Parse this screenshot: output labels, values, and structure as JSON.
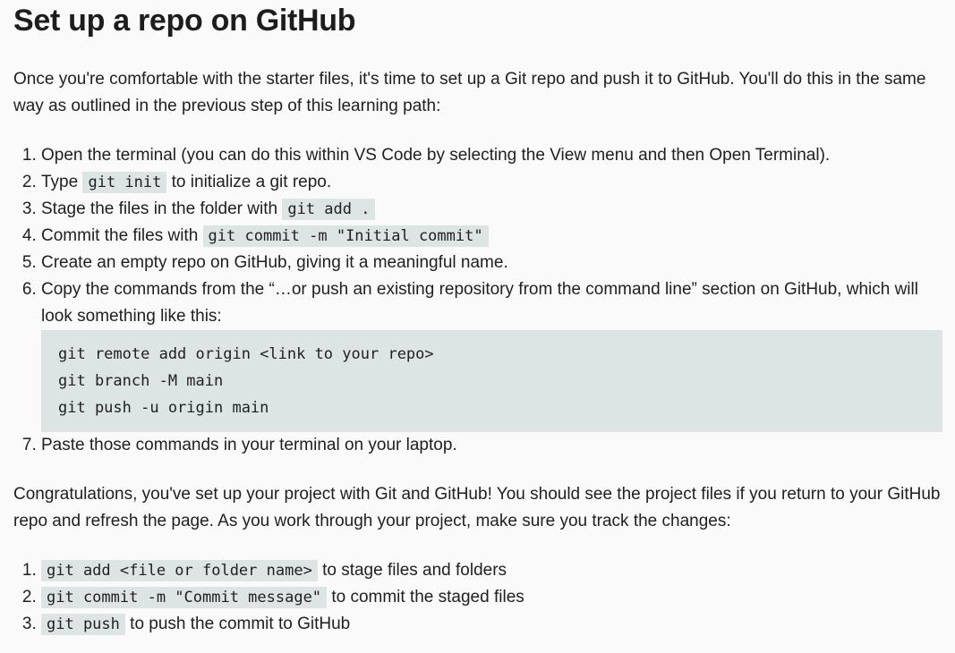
{
  "title": "Set up a repo on GitHub",
  "intro": "Once you're comfortable with the starter files, it's time to set up a Git repo and push it to GitHub. You'll do this in the same way as outlined in the previous step of this learning path:",
  "steps": [
    {
      "text": "Open the terminal (you can do this within VS Code by selecting the View menu and then Open Terminal)."
    },
    {
      "before": "Type ",
      "code": "git init",
      "after": " to initialize a git repo."
    },
    {
      "before": "Stage the files in the folder with ",
      "code": "git add .",
      "after": ""
    },
    {
      "before": "Commit the files with ",
      "code": "git commit -m \"Initial commit\"",
      "after": ""
    },
    {
      "text": "Create an empty repo on GitHub, giving it a meaningful name."
    },
    {
      "text": "Copy the commands from the “…or push an existing repository from the command line” section on GitHub, which will look something like this:"
    },
    {
      "text": "Paste those commands in your terminal on your laptop."
    }
  ],
  "code_block": [
    "git remote add origin <link to your repo>",
    "git branch -M main",
    "git push -u origin main"
  ],
  "congrats": "Congratulations, you've set up your project with Git and GitHub! You should see the project files if you return to your GitHub repo and refresh the page. As you work through your project, make sure you track the changes:",
  "track": [
    {
      "code": "git add <file or folder name>",
      "after": " to stage files and folders"
    },
    {
      "code": "git commit -m \"Commit message\"",
      "after": " to commit the staged files"
    },
    {
      "code": "git push",
      "after": " to push the commit to GitHub"
    }
  ]
}
